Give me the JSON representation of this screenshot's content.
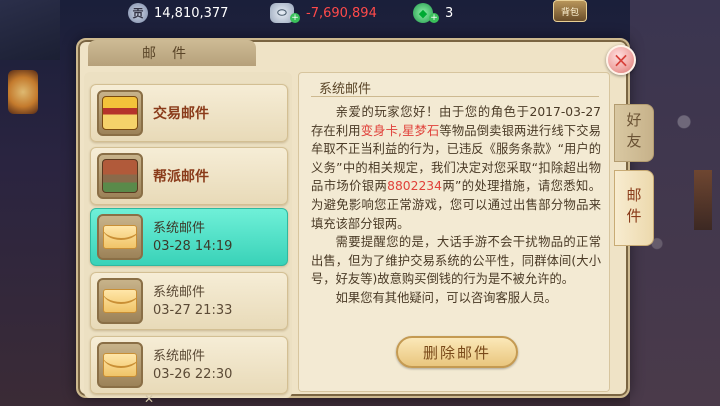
{
  "resources": {
    "gold": {
      "icon": "gold-coin-icon",
      "icon_text": "贡",
      "value": "14,810,377"
    },
    "silver": {
      "icon": "silver-ingot-icon",
      "value": "-7,690,894"
    },
    "jade": {
      "icon": "jade-icon",
      "value": "3"
    },
    "bag_label": "背包"
  },
  "panel": {
    "title": "邮件",
    "close_glyph": "×"
  },
  "mail_list": [
    {
      "type": "trade",
      "label": "交易邮件",
      "icon": "trade-shop-icon"
    },
    {
      "type": "guild",
      "label": "帮派邮件",
      "icon": "guild-building-icon"
    },
    {
      "type": "system",
      "label": "系统邮件",
      "date": "03-28 14:19",
      "icon": "envelope-icon",
      "selected": true
    },
    {
      "type": "system",
      "label": "系统邮件",
      "date": "03-27 21:33",
      "icon": "envelope-icon"
    },
    {
      "type": "system",
      "label": "系统邮件",
      "date": "03-26 22:30",
      "icon": "envelope-icon"
    }
  ],
  "content": {
    "title": "系统邮件",
    "p1_a": "亲爱的玩家您好！由于您的角色于2017-03-27存在利用",
    "p1_red1": "变身卡,星梦石",
    "p1_b": "等物品倒卖银两进行线下交易牟取不正当利益的行为，已违反《服务条款》“用户的义务”中的相关规定，我们决定对您采取“扣除超出物品市场价银两",
    "p1_red2": "8802234",
    "p1_c": "两”的处理措施，请您悉知。为避免影响您正常游戏，您可以通过出售部分物品来填充该部分银两。",
    "p2": "需要提醒您的是，大话手游不会干扰物品的正常出售，但为了维护交易系统的公平性，同群体间(大小号，好友等)故意购买倒钱的行为是不被允许的。",
    "p3": "如果您有其他疑问，可以咨询客服人员。"
  },
  "delete_button": "删除邮件",
  "side_tabs": {
    "friends": "好友",
    "mail": "邮件"
  }
}
